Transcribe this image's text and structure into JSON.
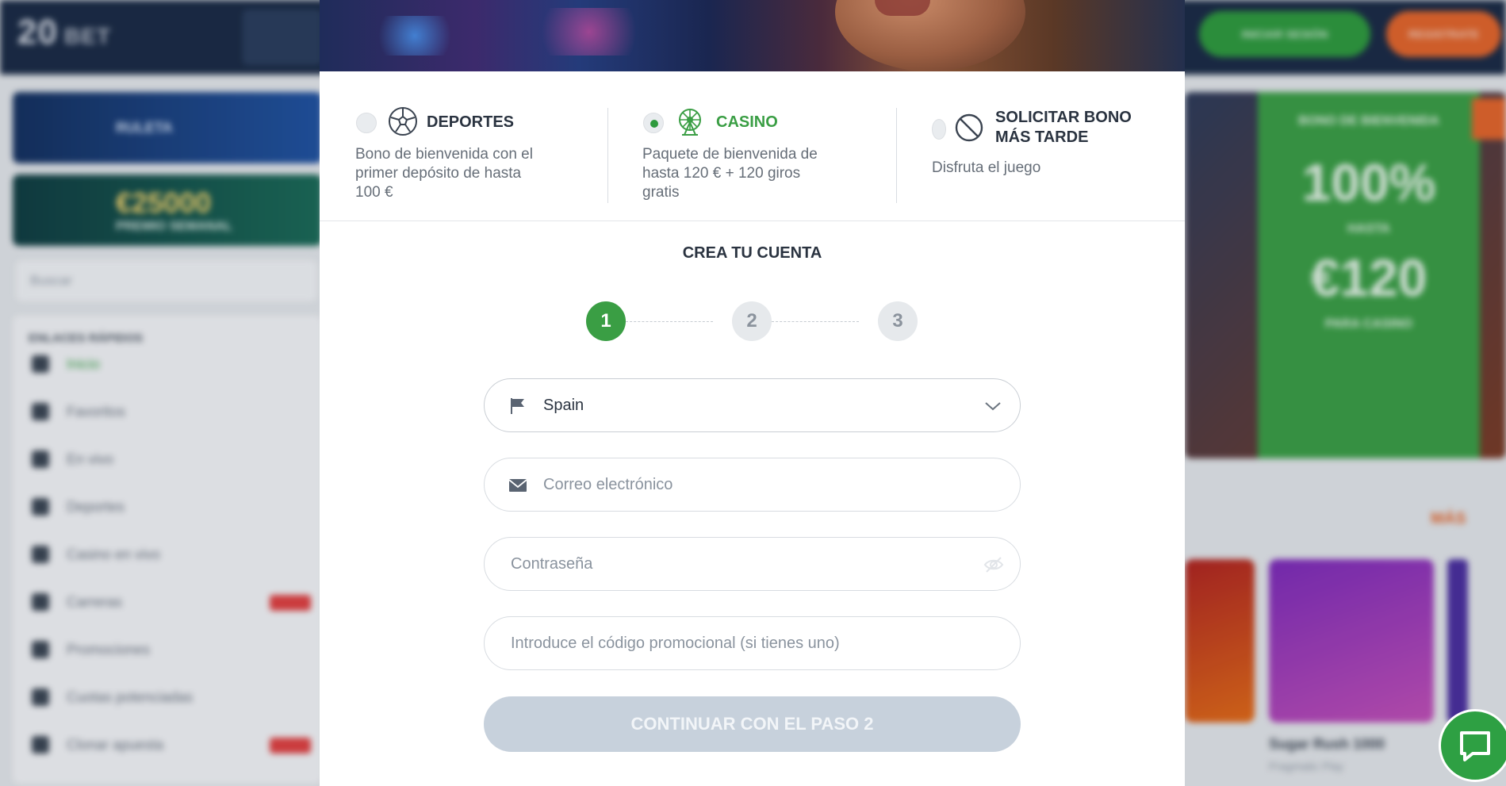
{
  "background": {
    "logo": "20",
    "logo_suffix": "BET",
    "login_label": "INICIAR SESIÓN",
    "register_label": "REGISTRATE",
    "banners": [
      "RULETA",
      "€25000"
    ],
    "banner_sub": "PREMIO SEMANAL",
    "search_placeholder": "Buscar",
    "quick_links_title": "ENLACES RÁPIDOS",
    "quick_links": [
      "Inicio",
      "Favoritos",
      "En vivo",
      "Deportes",
      "Casino en vivo",
      "Carreras",
      "Promociones",
      "Cuotas potenciadas",
      "Clonar apuesta"
    ],
    "promo_title": "BONO DE BIENVENIDA",
    "promo_big": "100%",
    "promo_upto": "HASTA",
    "promo_amount": "€120",
    "promo_for": "PARA CASINO",
    "more_label": "MÁS",
    "game_name": "Sugar Rush 1000",
    "game_provider": "Pragmatic Play"
  },
  "bonuses": [
    {
      "title": "DEPORTES",
      "desc_lines": [
        "Bono de bienvenida con el",
        "primer depósito de hasta",
        "100 €"
      ],
      "selected": false,
      "icon": "soccer-ball-icon"
    },
    {
      "title": "CASINO",
      "desc_lines": [
        "Paquete de bienvenida de",
        "hasta 120 € + 120 giros",
        "gratis"
      ],
      "selected": true,
      "icon": "ferris-wheel-icon"
    },
    {
      "title_lines": [
        "SOLICITAR BONO",
        "MÁS TARDE"
      ],
      "desc": "Disfruta el juego",
      "selected": false,
      "icon": "no-entry-icon"
    }
  ],
  "form": {
    "title": "CREA TU CUENTA",
    "steps": [
      "1",
      "2",
      "3"
    ],
    "active_step": 1,
    "country_value": "Spain",
    "email_placeholder": "Correo electrónico",
    "password_placeholder": "Contraseña",
    "promo_placeholder": "Introduce el código promocional (si tienes uno)",
    "continue_label": "CONTINUAR CON EL PASO 2"
  },
  "colors": {
    "accent_green": "#3a9e44",
    "button_disabled": "#c7d1dc",
    "header_bg": "#1a2a44"
  }
}
